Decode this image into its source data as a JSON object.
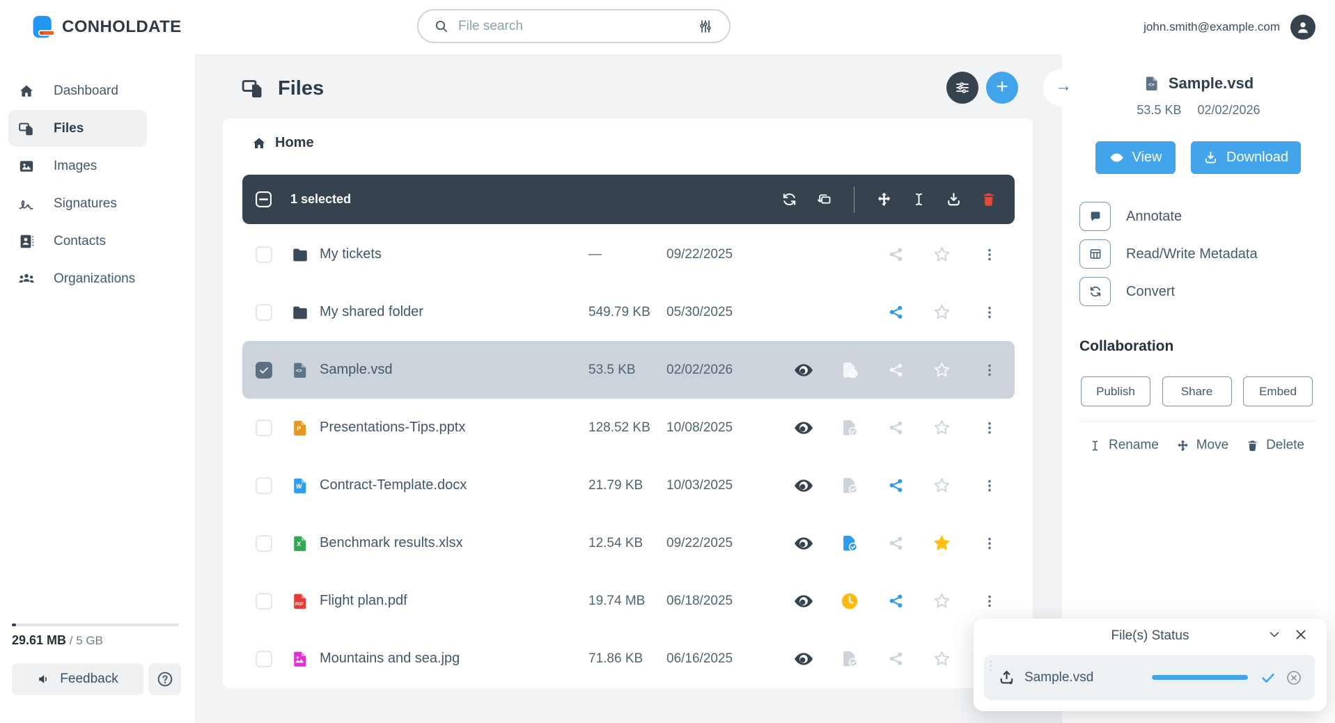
{
  "brand": {
    "name": "CONHOLDATE"
  },
  "header": {
    "search_placeholder": "File search",
    "user_email": "john.smith@example.com"
  },
  "sidebar": {
    "items": [
      {
        "label": "Dashboard",
        "icon": "home-icon",
        "active": false
      },
      {
        "label": "Files",
        "icon": "files-icon",
        "active": true
      },
      {
        "label": "Images",
        "icon": "image-icon",
        "active": false
      },
      {
        "label": "Signatures",
        "icon": "signature-icon",
        "active": false
      },
      {
        "label": "Contacts",
        "icon": "contacts-icon",
        "active": false
      },
      {
        "label": "Organizations",
        "icon": "organizations-icon",
        "active": false
      }
    ],
    "storage": {
      "used": "29.61 MB",
      "total": " / 5 GB"
    },
    "feedback_label": "Feedback"
  },
  "main": {
    "title": "Files",
    "breadcrumb": "Home",
    "toolbar": {
      "selected_count_label": "1 selected"
    },
    "rows": [
      {
        "name": "My tickets",
        "kind": "folder",
        "size": "—",
        "modified": "09/22/2025",
        "selected": false,
        "viewable": false,
        "status": "none",
        "shared": false,
        "starred": false
      },
      {
        "name": "My shared folder",
        "kind": "folder",
        "size": "549.79 KB",
        "modified": "05/30/2025",
        "selected": false,
        "viewable": false,
        "status": "none",
        "shared": true,
        "starred": false
      },
      {
        "name": "Sample.vsd",
        "kind": "vsd",
        "size": "53.5 KB",
        "modified": "02/02/2026",
        "selected": true,
        "viewable": true,
        "status": "checked",
        "shared": false,
        "starred": false
      },
      {
        "name": "Presentations-Tips.pptx",
        "kind": "pptx",
        "size": "128.52 KB",
        "modified": "10/08/2025",
        "selected": false,
        "viewable": true,
        "status": "checked",
        "shared": false,
        "starred": false
      },
      {
        "name": "Contract-Template.docx",
        "kind": "docx",
        "size": "21.79 KB",
        "modified": "10/03/2025",
        "selected": false,
        "viewable": true,
        "status": "checked",
        "shared": true,
        "starred": false
      },
      {
        "name": "Benchmark results.xlsx",
        "kind": "xlsx",
        "size": "12.54 KB",
        "modified": "09/22/2025",
        "selected": false,
        "viewable": true,
        "status": "checked-active",
        "shared": false,
        "starred": true
      },
      {
        "name": "Flight plan.pdf",
        "kind": "pdf",
        "size": "19.74 MB",
        "modified": "06/18/2025",
        "selected": false,
        "viewable": true,
        "status": "pending",
        "shared": true,
        "starred": false
      },
      {
        "name": "Mountains and sea.jpg",
        "kind": "jpg",
        "size": "71.86 KB",
        "modified": "06/16/2025",
        "selected": false,
        "viewable": true,
        "status": "checked",
        "shared": false,
        "starred": false
      }
    ]
  },
  "details": {
    "file_name": "Sample.vsd",
    "file_size": "53.5 KB",
    "file_date": "02/02/2026",
    "view_label": "View",
    "download_label": "Download",
    "tools": [
      {
        "label": "Annotate",
        "icon": "comment-icon"
      },
      {
        "label": "Read/Write Metadata",
        "icon": "table-icon"
      },
      {
        "label": "Convert",
        "icon": "convert-icon"
      }
    ],
    "collaboration_title": "Collaboration",
    "collaboration_buttons": [
      "Publish",
      "Share",
      "Embed"
    ],
    "actions": [
      "Rename",
      "Move",
      "Delete"
    ]
  },
  "status_panel": {
    "title": "File(s) Status",
    "file_name": "Sample.vsd",
    "progress_percent": 100
  },
  "icons": {
    "plus": "+",
    "arrow_right": "→",
    "question_mark": "?",
    "file_letters": {
      "vsd": "<>",
      "pptx": "P",
      "docx": "W",
      "xlsx": "X",
      "pdf": "PDF"
    }
  },
  "colors": {
    "accent_blue": "#42a5eb",
    "dark_slate": "#36424e",
    "selected_row": "#ccd3da",
    "star_yellow": "#fdc00f",
    "pending_yellow": "#fdbb11",
    "danger_red": "#e8483e",
    "icon_muted": "#ccd3da"
  }
}
